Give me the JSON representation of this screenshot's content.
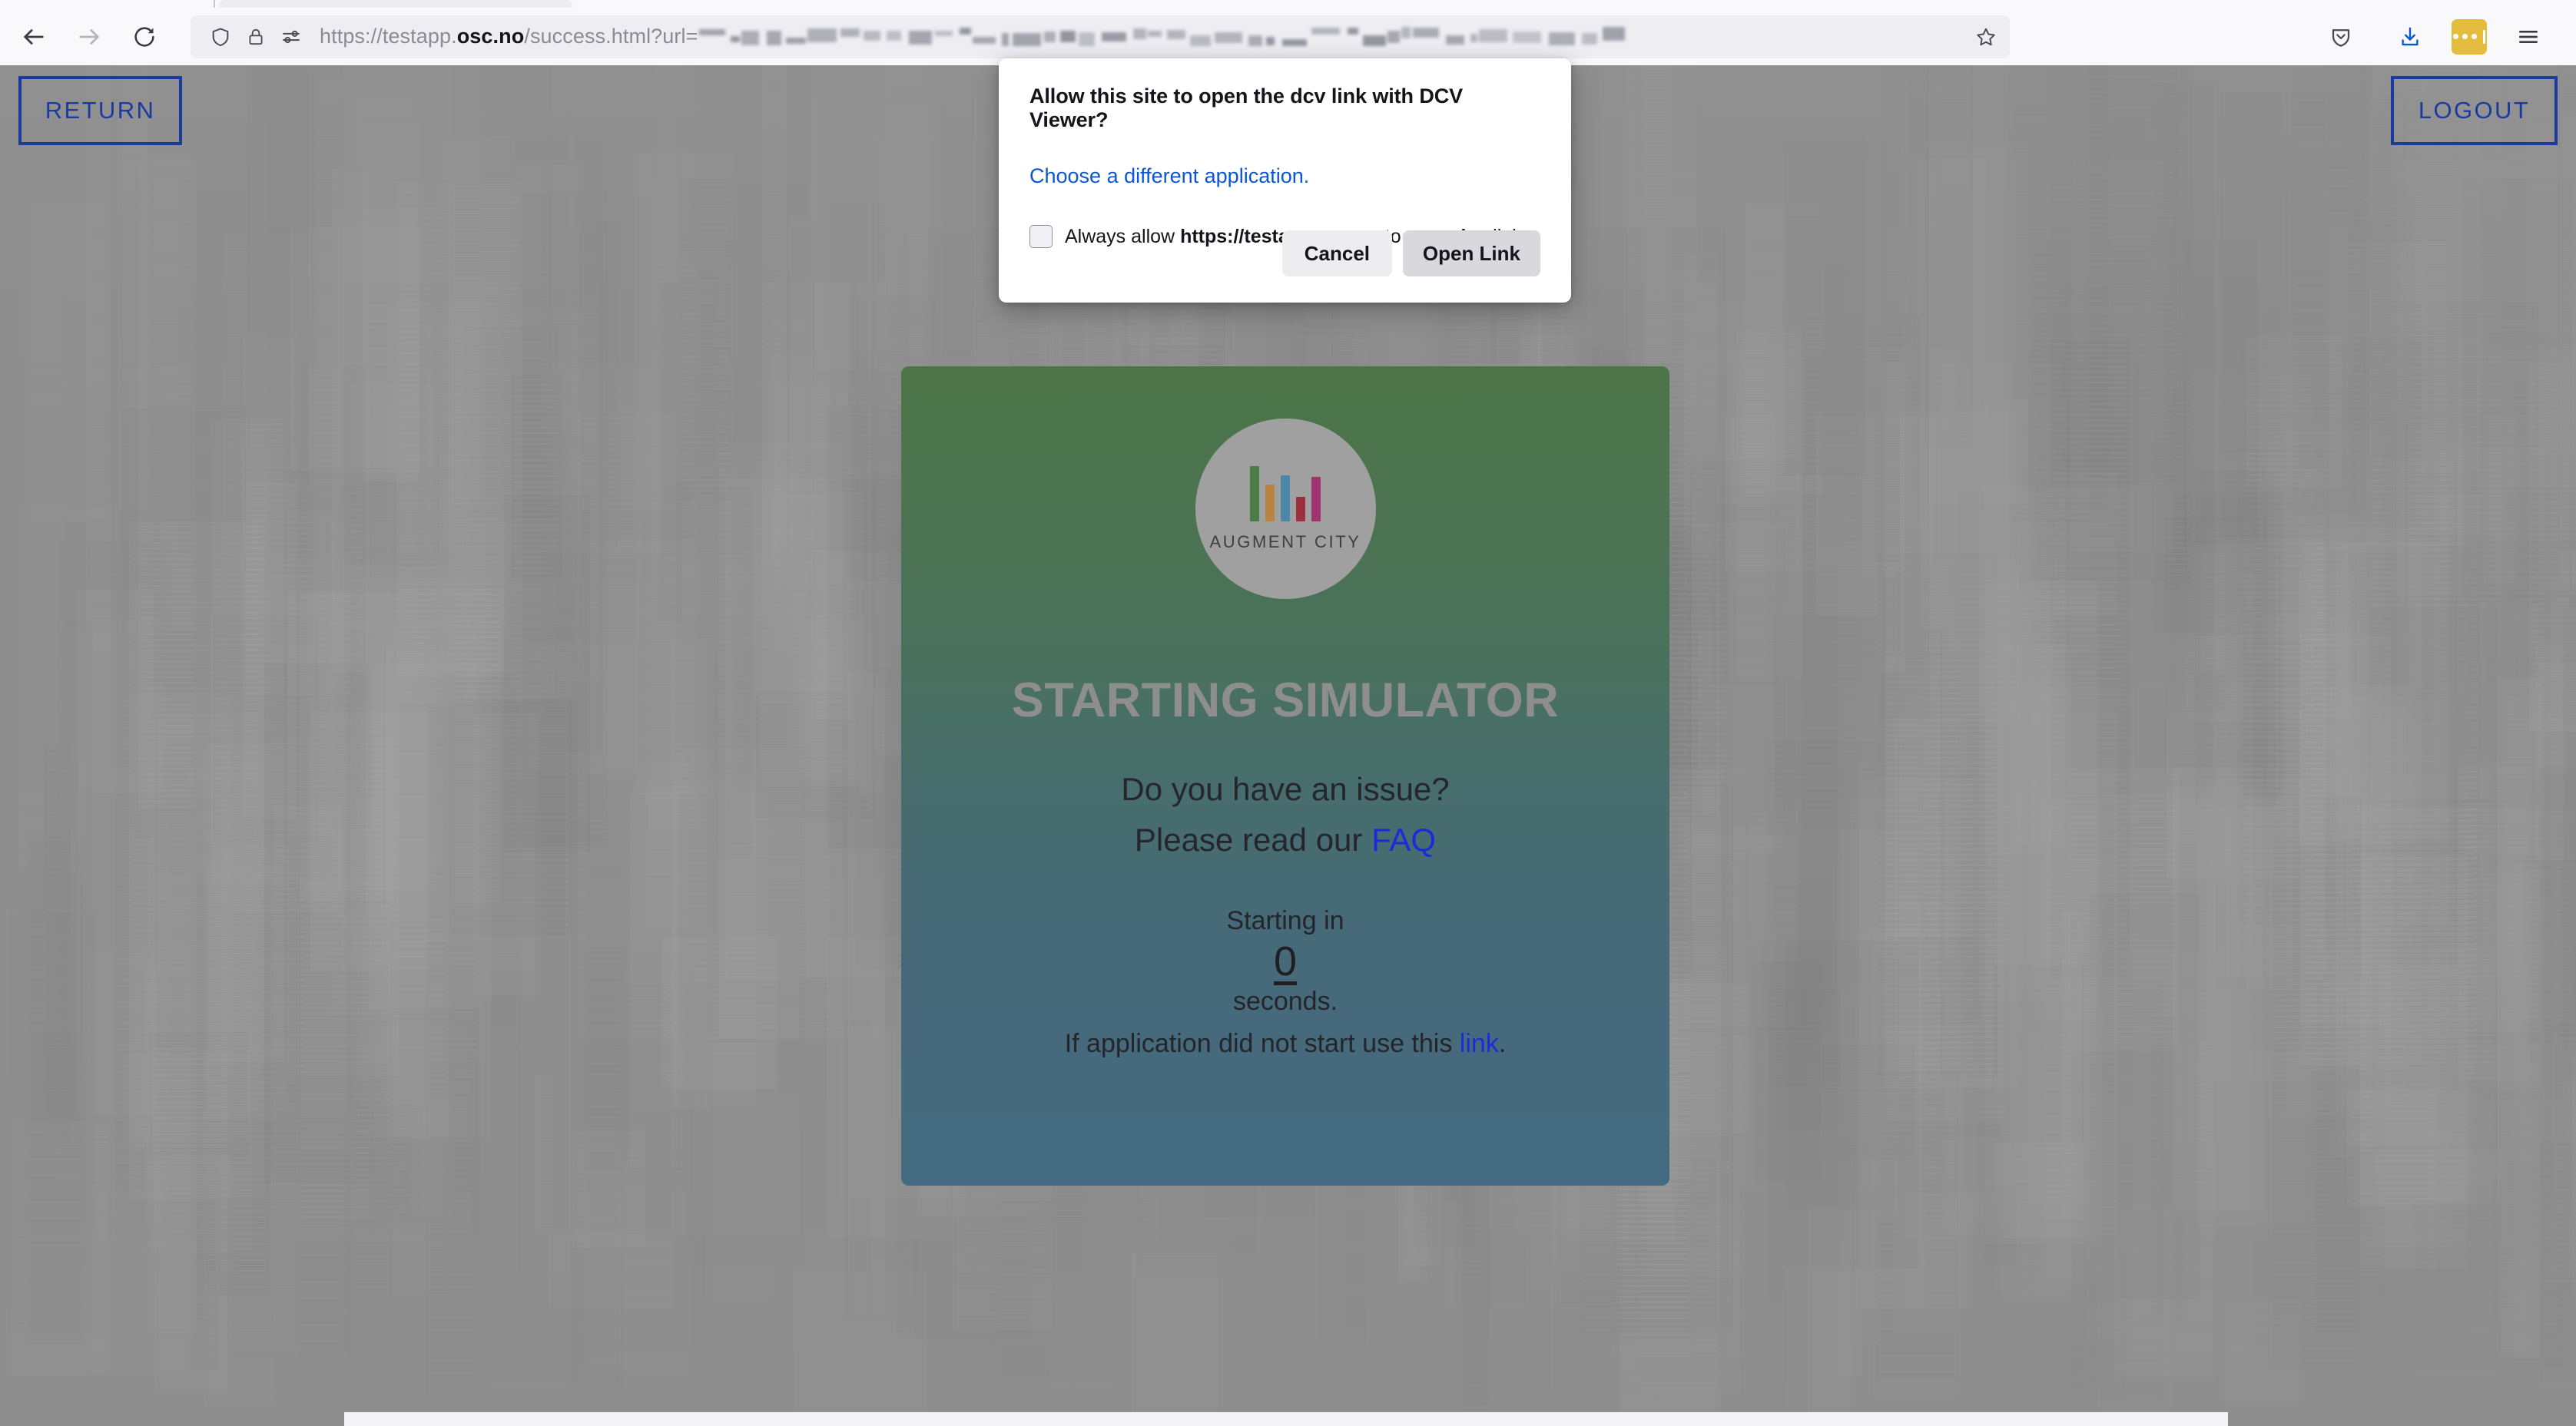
{
  "browser": {
    "url": {
      "prefix": "https://testapp.",
      "domain": "osc.no",
      "path": "/success.html?url=",
      "redacted_note": "(obfuscated query string)"
    },
    "nav_icons": [
      "back-arrow-icon",
      "forward-arrow-icon",
      "reload-icon"
    ],
    "urlbar_icons": [
      "shield-icon",
      "lock-icon",
      "permissions-icon",
      "bookmark-star-icon"
    ],
    "toolbar_right_icons": [
      "pocket-save-icon",
      "downloads-icon",
      "extension-badge-icon",
      "app-menu-icon"
    ]
  },
  "page": {
    "return_button": "RETURN",
    "logout_button": "LOGOUT",
    "card": {
      "logo_wordmark": "AUGMENT CITY",
      "heading": "STARTING SIMULATOR",
      "question": "Do you have an issue?",
      "read_prefix": "Please read our ",
      "faq_link": "FAQ",
      "starting_in": "Starting in",
      "countdown": "0",
      "seconds_label": "seconds.",
      "fallback_prefix": "If application did not start use this ",
      "fallback_link": "link",
      "fallback_suffix": "."
    }
  },
  "dialog": {
    "title": "Allow this site to open the dcv link with DCV Viewer?",
    "choose_app_link": "Choose a different application.",
    "always_allow": {
      "prefix": "Always allow ",
      "origin": "https://testapp.osc.no",
      "middle": " to open ",
      "scheme": "dcv",
      "suffix": " links",
      "checked": false
    },
    "cancel_label": "Cancel",
    "open_label": "Open Link"
  },
  "colors": {
    "brand_blue": "#1a3a9e",
    "link_blue": "#1a2bd8",
    "dialog_link_blue": "#0a57d0",
    "card_top": "#4d7548",
    "card_bottom": "#456b82",
    "logo_circle": "#a0a0a0",
    "heading_grey": "#8e8e8e",
    "extension_badge_yellow": "#e5bd3e",
    "download_blue": "#0a57d0"
  },
  "logo_bars": [
    {
      "color": "#4a7c45",
      "height": 72
    },
    {
      "color": "#b8833e",
      "height": 48
    },
    {
      "color": "#4a87a8",
      "height": 60
    },
    {
      "color": "#9e2f3e",
      "height": 32
    },
    {
      "color": "#9e3370",
      "height": 58
    }
  ]
}
